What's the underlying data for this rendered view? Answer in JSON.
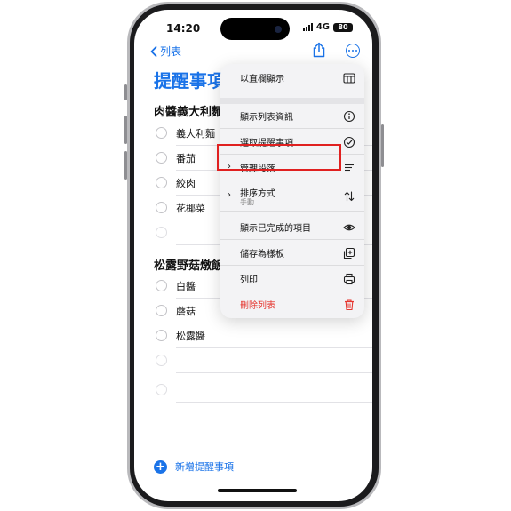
{
  "status": {
    "time": "14:20",
    "network": "4G",
    "battery": "80"
  },
  "nav": {
    "back_label": "列表"
  },
  "page": {
    "title": "提醒事項"
  },
  "sections": [
    {
      "title": "肉醬義大利麵",
      "items": [
        "義大利麵",
        "番茄",
        "絞肉",
        "花椰菜",
        ""
      ]
    },
    {
      "title": "松露野菇燉飯",
      "items": [
        "白醬",
        "蘑菇",
        "松露醬",
        "",
        ""
      ]
    }
  ],
  "add_reminder_label": "新增提醒事項",
  "menu": {
    "items": [
      {
        "label": "以直欄顯示",
        "icon": "columns-icon"
      },
      {
        "label": "顯示列表資訊",
        "icon": "info-icon"
      },
      {
        "label": "選取提醒事項",
        "icon": "checkmark-circle-icon"
      },
      {
        "label": "管理段落",
        "icon": "list-lines-icon",
        "has_submenu": true
      },
      {
        "label": "排序方式",
        "sublabel": "手動",
        "icon": "sort-arrows-icon",
        "has_submenu": true
      },
      {
        "label": "顯示已完成的項目",
        "icon": "eye-icon"
      },
      {
        "label": "儲存為樣板",
        "icon": "plus-square-icon"
      },
      {
        "label": "列印",
        "icon": "printer-icon"
      },
      {
        "label": "刪除列表",
        "icon": "trash-icon",
        "destructive": true
      }
    ]
  },
  "colors": {
    "accent": "#1a73e8",
    "destructive": "#e5362f",
    "highlight": "#e02020"
  }
}
